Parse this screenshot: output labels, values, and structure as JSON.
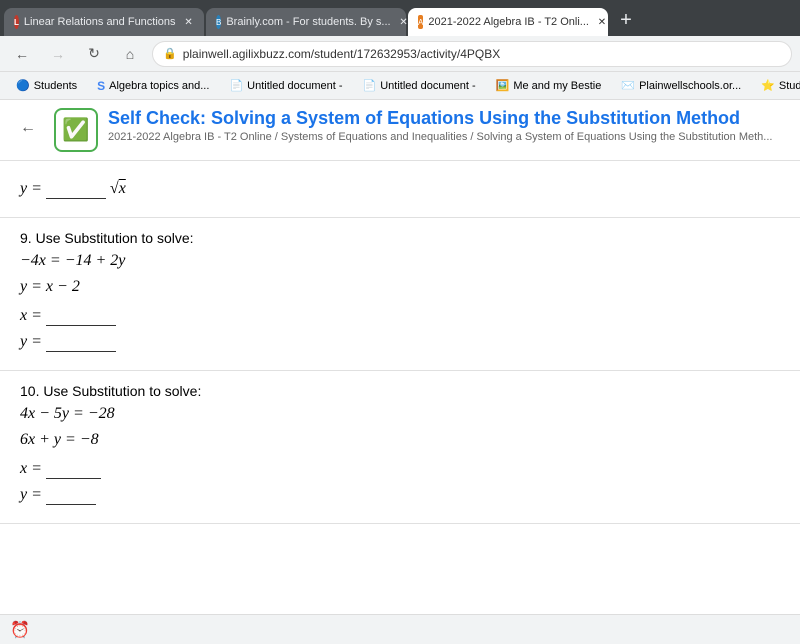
{
  "browser": {
    "tabs": [
      {
        "id": "tab1",
        "label": "Linear Relations and Functions",
        "active": false,
        "favicon_type": "red-circle"
      },
      {
        "id": "tab2",
        "label": "Brainly.com - For students. By s...",
        "active": false,
        "favicon_type": "brainly"
      },
      {
        "id": "tab3",
        "label": "2021-2022 Algebra IB - T2 Onli...",
        "active": true,
        "favicon_type": "orange-circle"
      }
    ],
    "url": "plainwell.agilixbuzz.com/student/172632953/activity/4PQBX",
    "new_tab_label": "+",
    "back_disabled": false,
    "forward_disabled": true
  },
  "bookmarks": [
    {
      "label": "Students",
      "favicon_type": "google"
    },
    {
      "label": "Algebra topics and...",
      "favicon_type": "s-icon"
    },
    {
      "label": "Untitled document -",
      "favicon_type": "doc"
    },
    {
      "label": "Untitled document -",
      "favicon_type": "doc"
    },
    {
      "label": "Me and my Bestie",
      "favicon_type": "image"
    },
    {
      "label": "Plainwellschools.or...",
      "favicon_type": "mail"
    },
    {
      "label": "Student A",
      "favicon_type": "star"
    }
  ],
  "page_header": {
    "title": "Self Check: Solving a System of Equations Using the Substitution Method",
    "breadcrumb": "2021-2022 Algebra IB - T2 Online / Systems of Equations and Inequalities / Solving a System of Equations Using the Substitution Meth...",
    "back_label": "←"
  },
  "sections": [
    {
      "id": "top-section",
      "equation_line1": "y = ",
      "equation_line2": "√x",
      "show_answer": false
    },
    {
      "id": "section9",
      "number": "9.",
      "instruction": "Use Substitution to solve:",
      "equations": [
        "−4x = −14 + 2y",
        "y = x − 2"
      ],
      "answer_x_label": "x =",
      "answer_y_label": "y ="
    },
    {
      "id": "section10",
      "number": "10.",
      "instruction": "Use Substitution to solve:",
      "equations": [
        "4x − 5y = −28",
        "6x + y = −8"
      ],
      "answer_x_label": "x =",
      "answer_y_label": "y ="
    }
  ],
  "bottom_bar": {
    "time": "⏰"
  }
}
